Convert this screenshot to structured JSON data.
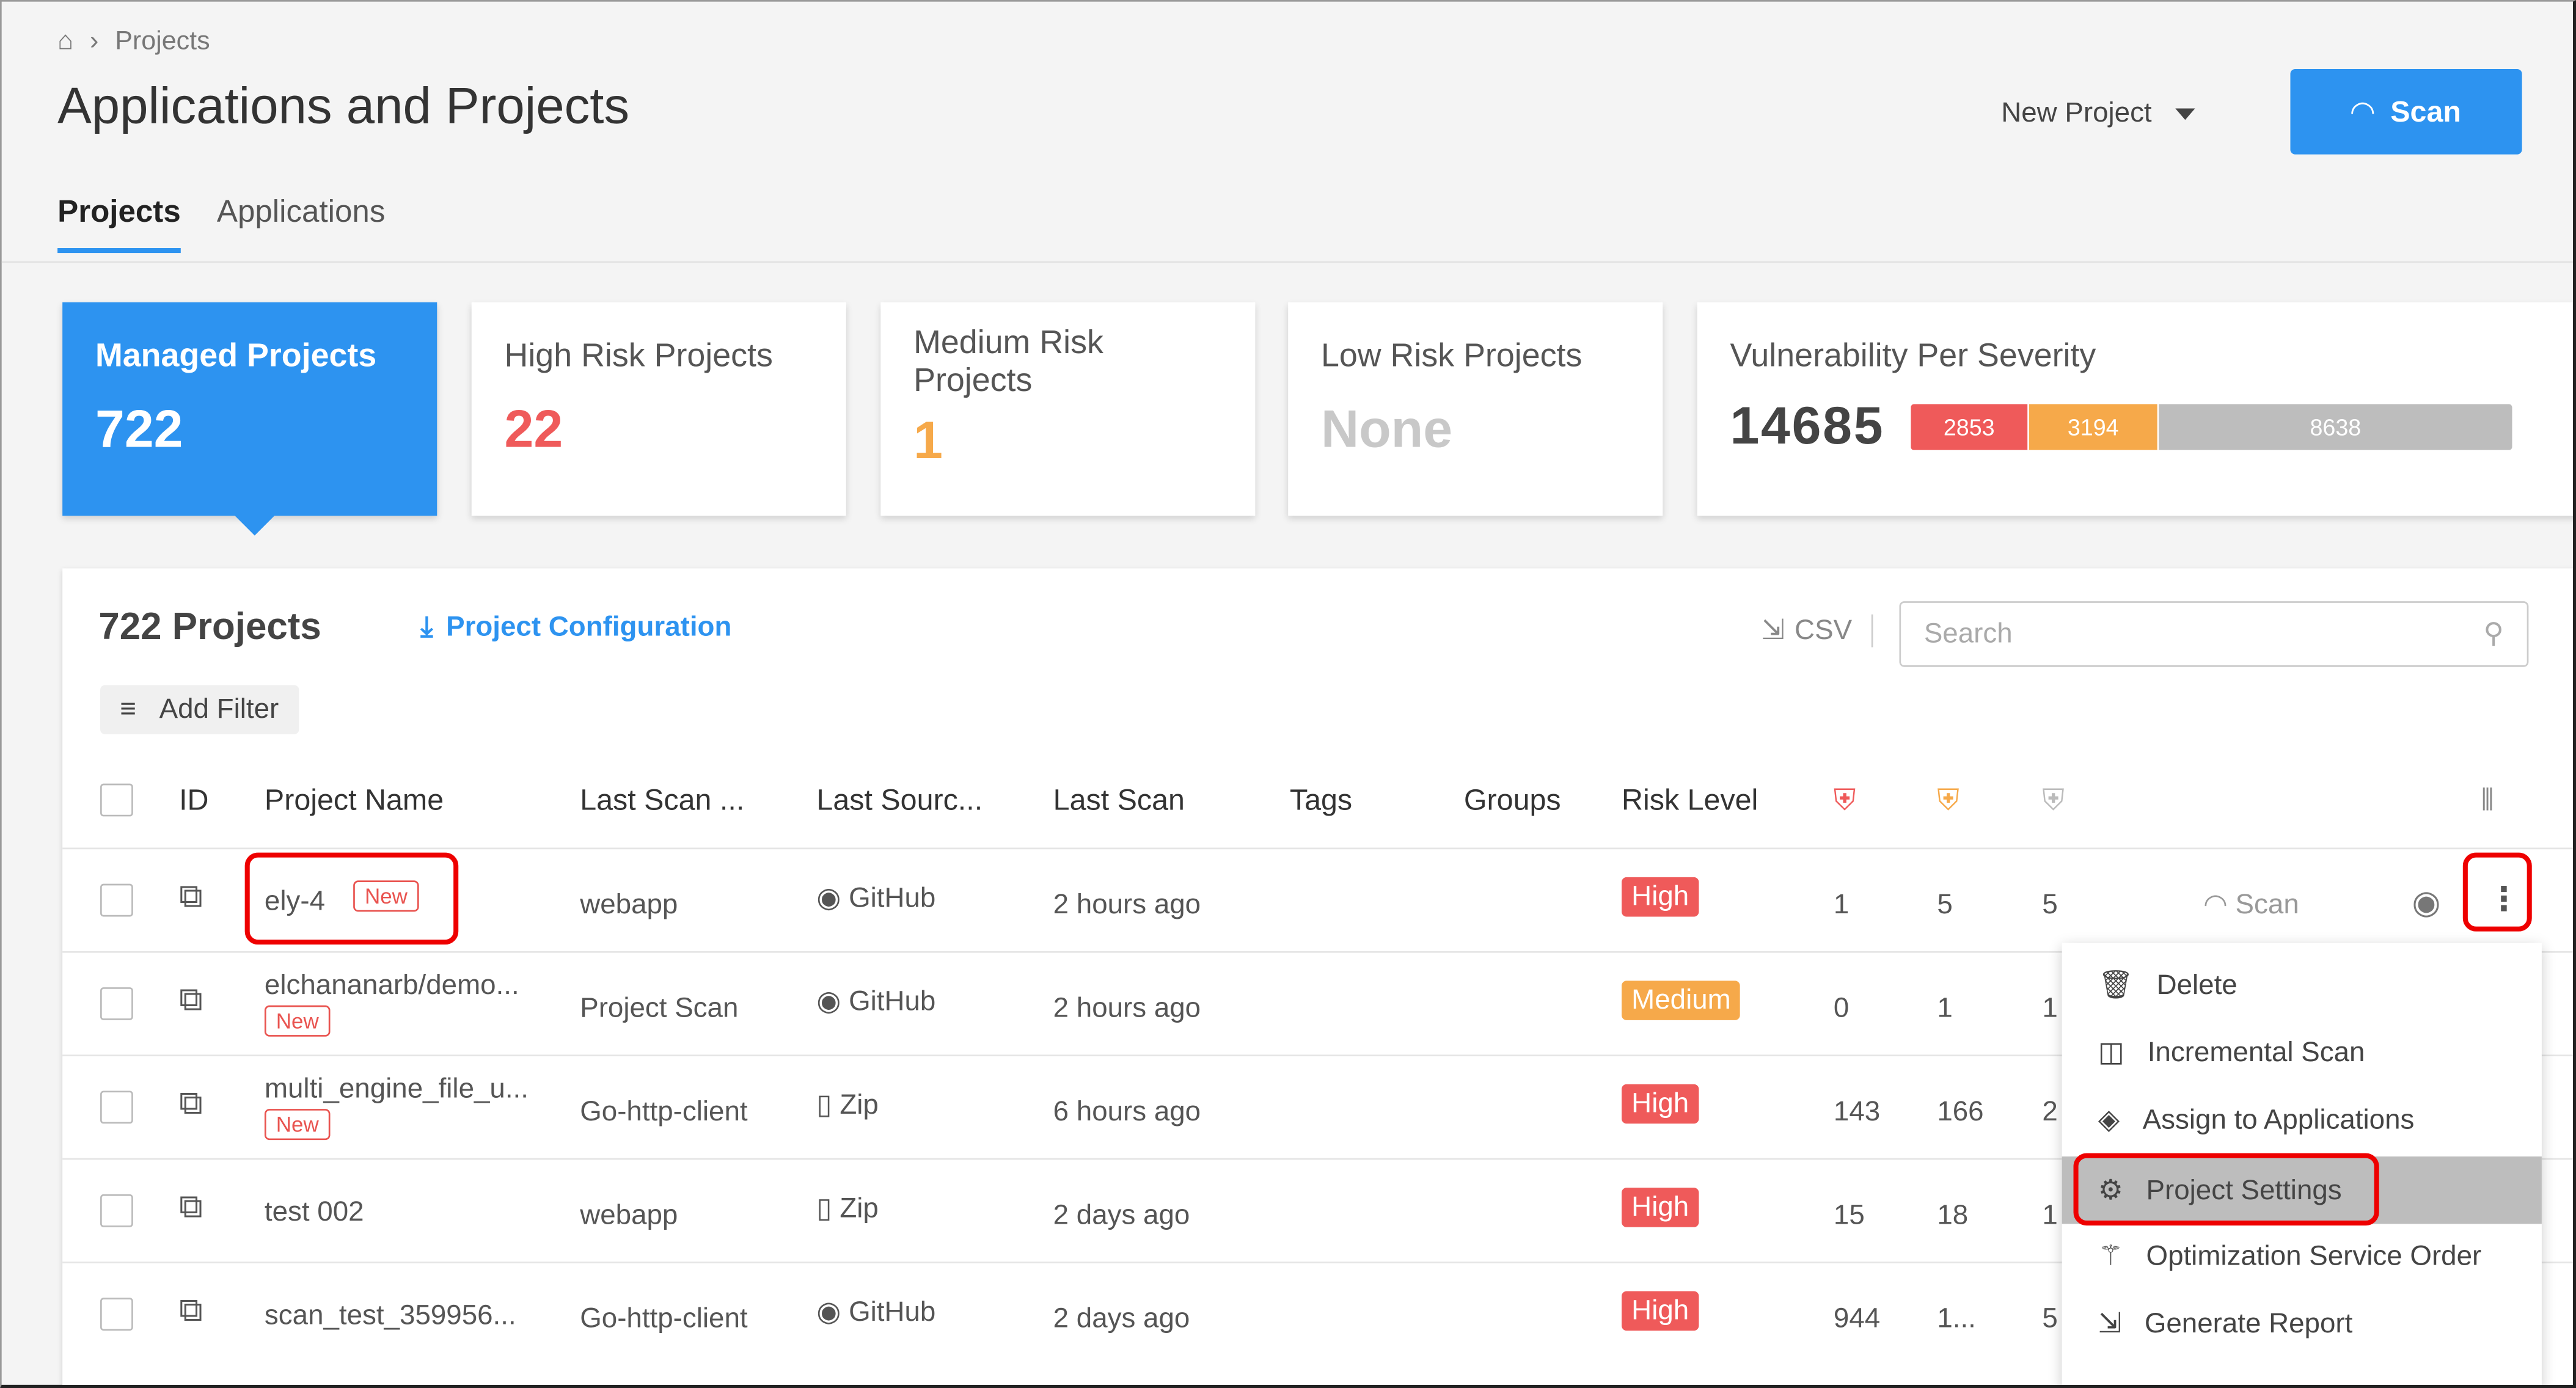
{
  "breadcrumb": {
    "items": [
      "Projects"
    ]
  },
  "header": {
    "title": "Applications and Projects",
    "new_project": "New Project",
    "scan": "Scan"
  },
  "tabs": [
    {
      "label": "Projects",
      "active": true
    },
    {
      "label": "Applications",
      "active": false
    }
  ],
  "cards": {
    "managed": {
      "label": "Managed Projects",
      "value": "722"
    },
    "high": {
      "label": "High Risk Projects",
      "value": "22"
    },
    "medium": {
      "label": "Medium Risk Projects",
      "value": "1"
    },
    "low": {
      "label": "Low Risk Projects",
      "value": "None"
    },
    "severity": {
      "label": "Vulnerability Per Severity",
      "total": "14685",
      "high": "2853",
      "medium": "3194",
      "low": "8638"
    }
  },
  "colors": {
    "accent": "#2d93f0",
    "high": "#ef5a5a",
    "medium": "#f6a94a",
    "low": "#bdbdbd"
  },
  "table": {
    "count_label": "722 Projects",
    "project_config": "Project Configuration",
    "csv": "CSV",
    "search_placeholder": "Search",
    "add_filter": "Add Filter",
    "columns": [
      "ID",
      "Project Name",
      "Last Scan ...",
      "Last Sourc...",
      "Last Scan",
      "Tags",
      "Groups",
      "Risk Level"
    ],
    "rows": [
      {
        "name": "ely-4",
        "new": "New",
        "last_scan_type": "webapp",
        "source": "GitHub",
        "last_scan": "2 hours ago",
        "risk": "High",
        "h": "1",
        "m": "5",
        "l": "5",
        "scan": "Scan"
      },
      {
        "name": "elchananarb/demo...",
        "new": "New",
        "last_scan_type": "Project Scan",
        "source": "GitHub",
        "last_scan": "2 hours ago",
        "risk": "Medium",
        "h": "0",
        "m": "1",
        "l": "1"
      },
      {
        "name": "multi_engine_file_u...",
        "new": "New",
        "last_scan_type": "Go-http-client",
        "source": "Zip",
        "last_scan": "6 hours ago",
        "risk": "High",
        "h": "143",
        "m": "166",
        "l": "2"
      },
      {
        "name": "test 002",
        "last_scan_type": "webapp",
        "source": "Zip",
        "last_scan": "2 days ago",
        "risk": "High",
        "h": "15",
        "m": "18",
        "l": "1"
      },
      {
        "name": "scan_test_359956...",
        "last_scan_type": "Go-http-client",
        "source": "GitHub",
        "last_scan": "2 days ago",
        "risk": "High",
        "h": "944",
        "m": "1...",
        "l": "5"
      }
    ]
  },
  "menu": {
    "items": [
      "Delete",
      "Incremental Scan",
      "Assign to Applications",
      "Project Settings",
      "Optimization Service Order",
      "Generate Report"
    ],
    "selected": "Project Settings"
  }
}
